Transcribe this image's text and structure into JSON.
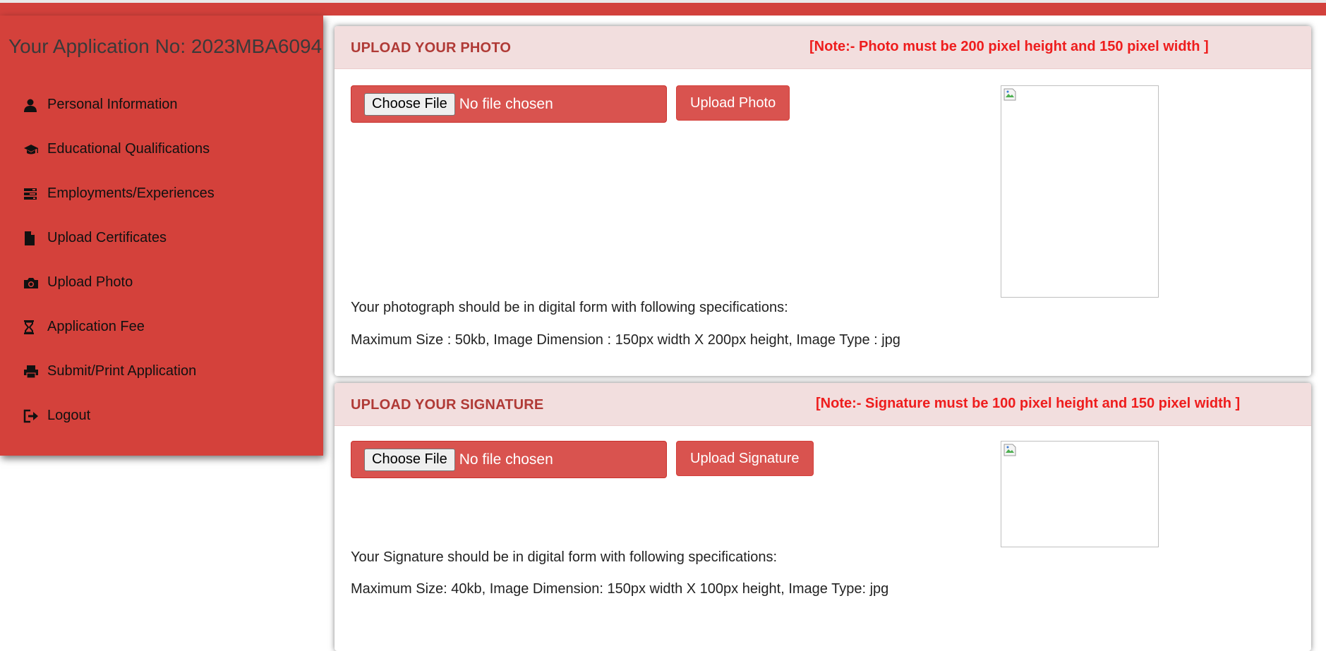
{
  "header": {
    "application_no": "Your Application No: 2023MBA6094"
  },
  "sidebar": {
    "items": [
      {
        "label": "Personal Information",
        "icon": "user-icon"
      },
      {
        "label": "Educational Qualifications",
        "icon": "graduation-cap-icon"
      },
      {
        "label": "Employments/Experiences",
        "icon": "tasks-icon"
      },
      {
        "label": "Upload Certificates",
        "icon": "file-icon"
      },
      {
        "label": "Upload Photo",
        "icon": "camera-icon"
      },
      {
        "label": "Application Fee",
        "icon": "hourglass-icon"
      },
      {
        "label": "Submit/Print Application",
        "icon": "print-icon"
      },
      {
        "label": "Logout",
        "icon": "logout-icon"
      }
    ]
  },
  "photo_panel": {
    "title": "UPLOAD YOUR PHOTO",
    "note": "[Note:- Photo must be 200 pixel height and 150 pixel width ]",
    "choose_label": "Choose File",
    "file_status": "No file chosen",
    "upload_label": "Upload Photo",
    "spec_line1": "Your photograph should be in digital form with following specifications:",
    "spec_line2": "Maximum Size : 50kb, Image Dimension : 150px width X 200px height, Image Type : jpg"
  },
  "signature_panel": {
    "title": "UPLOAD YOUR SIGNATURE",
    "note": "[Note:- Signature must be 100 pixel height and 150 pixel width ]",
    "choose_label": "Choose File",
    "file_status": "No file chosen",
    "upload_label": "Upload Signature",
    "spec_line1": "Your Signature should be in digital form with following specifications:",
    "spec_line2": "Maximum Size: 40kb, Image Dimension: 150px width X 100px height, Image Type: jpg"
  },
  "colors": {
    "primary_red": "#d9534f",
    "sidebar_red": "#d4413b",
    "panel_heading_bg": "#f2dede",
    "title_text": "#b03a36",
    "note_text": "#ee1d1d"
  }
}
